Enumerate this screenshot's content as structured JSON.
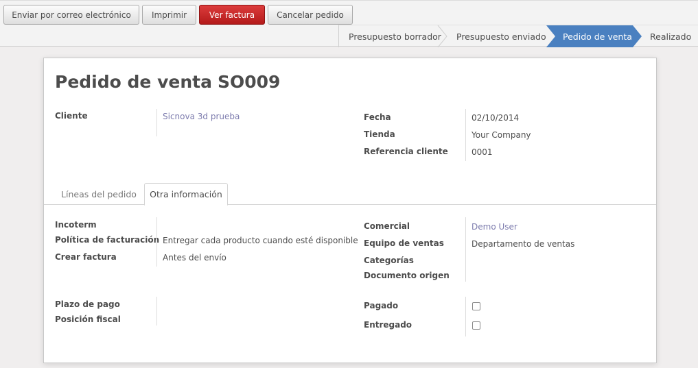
{
  "toolbar": {
    "buttons": {
      "email": "Enviar por correo electrónico",
      "print": "Imprimir",
      "view_invoice": "Ver factura",
      "cancel_order": "Cancelar pedido"
    }
  },
  "statusbar": {
    "stages": [
      "Presupuesto borrador",
      "Presupuesto enviado",
      "Pedido de venta",
      "Realizado"
    ],
    "active": "Pedido de venta",
    "active_color": "#4a80c0"
  },
  "form": {
    "title_prefix": "Pedido de venta",
    "order_number": "SO009",
    "left": {
      "customer_label": "Cliente",
      "customer_value": "Sicnova 3d prueba"
    },
    "right": {
      "date_label": "Fecha",
      "date_value": "02/10/2014",
      "shop_label": "Tienda",
      "shop_value": "Your Company",
      "ref_label": "Referencia cliente",
      "ref_value": "0001"
    },
    "tabs": [
      "Líneas del pedido",
      "Otra información"
    ],
    "active_tab": "Otra información",
    "other_info": {
      "incoterm_label": "Incoterm",
      "incoterm_value": "",
      "billing_policy_label": "Política de facturación",
      "billing_policy_value": "Entregar cada producto cuando esté disponible",
      "create_invoice_label": "Crear factura",
      "create_invoice_value": "Antes del envío",
      "salesperson_label": "Comercial",
      "salesperson_value": "Demo User",
      "sales_team_label": "Equipo de ventas",
      "sales_team_value": "Departamento de ventas",
      "categories_label": "Categorías",
      "categories_value": "",
      "source_doc_label": "Documento origen",
      "source_doc_value": "",
      "payment_term_label": "Plazo de pago",
      "payment_term_value": "",
      "fiscal_position_label": "Posición fiscal",
      "fiscal_position_value": "",
      "paid_label": "Pagado",
      "paid_checked": false,
      "delivered_label": "Entregado",
      "delivered_checked": false
    }
  }
}
